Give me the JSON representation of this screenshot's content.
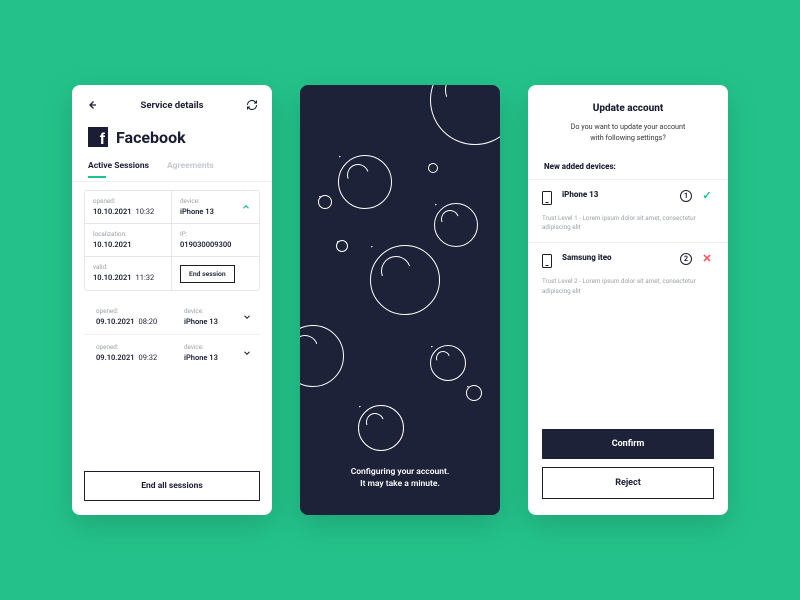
{
  "phone1": {
    "header_title": "Service details",
    "brand_name": "Facebook",
    "tabs": {
      "active": "Active Sessions",
      "inactive": "Agreements"
    },
    "expanded": {
      "opened_label": "opened:",
      "opened_value": "10.10.2021",
      "opened_time": "10:32",
      "device_label": "device:",
      "device_value": "iPhone 13",
      "loc_label": "localization:",
      "loc_value": "10.10.2021",
      "ip_label": "IP:",
      "ip_value": "019030009300",
      "valid_label": "valid:",
      "valid_value": "10.10.2021",
      "valid_time": "11:32",
      "end_session": "End session"
    },
    "collapsed": [
      {
        "opened_label": "opened:",
        "opened": "09.10.2021",
        "time": "08:20",
        "device_label": "device:",
        "device": "iPhone 13"
      },
      {
        "opened_label": "opened:",
        "opened": "09.10.2021",
        "time": "09:32",
        "device_label": "device:",
        "device": "iPhone 13"
      }
    ],
    "end_all": "End all sessions"
  },
  "phone2": {
    "line1": "Configuring your account.",
    "line2": "It may take a minute."
  },
  "phone3": {
    "title": "Update account",
    "sub1": "Do you want to update your account",
    "sub2": "with following settings?",
    "section": "New added devices:",
    "devices": [
      {
        "name": "iPhone 13",
        "badge": "1",
        "desc": "Trust Level 1 - Lorem ipsum dolor sit amet, consectetur adipiscing elit",
        "status": "ok"
      },
      {
        "name": "Samsung iteo",
        "badge": "2",
        "desc": "Trust Level 2 - Lorem ipsum dolor sit amet, consectetur adipiscing elit",
        "status": "no"
      }
    ],
    "confirm": "Confirm",
    "reject": "Reject"
  }
}
